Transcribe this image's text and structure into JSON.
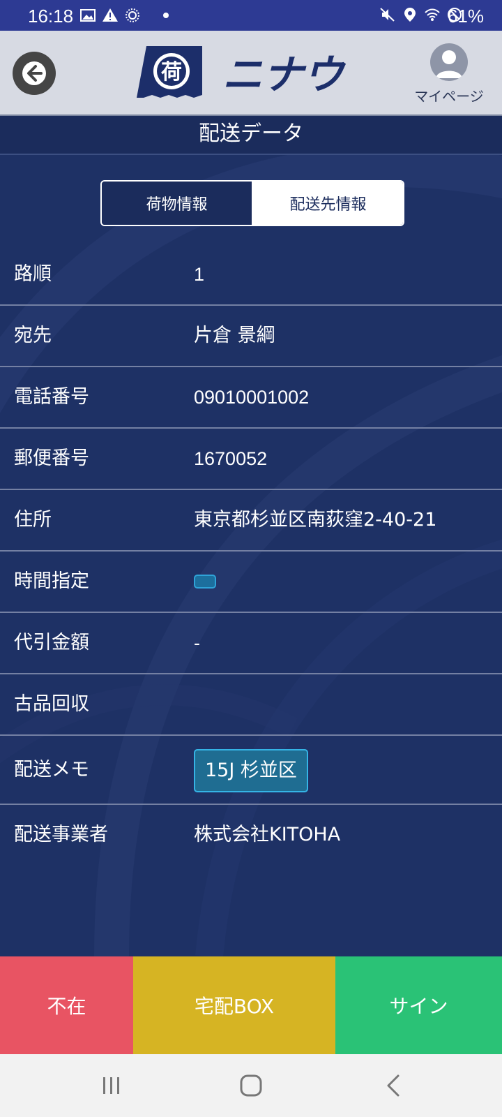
{
  "status_bar": {
    "time": "16:18",
    "left_icons": [
      "image-icon",
      "warning-icon",
      "sync-icon",
      "dot-icon"
    ],
    "right_icons": [
      "mute-icon",
      "location-icon",
      "wifi-icon",
      "dnd-icon"
    ],
    "battery": "61%"
  },
  "header": {
    "logo_text": "ニナウ",
    "logo_mark": "荷",
    "mypage_label": "マイページ"
  },
  "title": "配送データ",
  "tabs": [
    {
      "label": "荷物情報",
      "active": false
    },
    {
      "label": "配送先情報",
      "active": true
    }
  ],
  "rows": [
    {
      "label": "路順",
      "value": "1"
    },
    {
      "label": "宛先",
      "value": "片倉 景綱"
    },
    {
      "label": "電話番号",
      "value": "09010001002"
    },
    {
      "label": "郵便番号",
      "value": "1670052"
    },
    {
      "label": "住所",
      "value": "東京都杉並区南荻窪2-40-21"
    },
    {
      "label": "時間指定",
      "value": ""
    },
    {
      "label": "代引金額",
      "value": "-"
    },
    {
      "label": "古品回収",
      "value": ""
    },
    {
      "label": "配送メモ",
      "value": "15J 杉並区"
    },
    {
      "label": "配送事業者",
      "value": "株式会社KITOHA"
    }
  ],
  "actions": {
    "absent": "不在",
    "delivery_box": "宅配BOX",
    "sign": "サイン"
  },
  "colors": {
    "status_bar": "#2d3a93",
    "header_bg": "#d7dae3",
    "main_bg": "#1e3165",
    "absent": "#e85463",
    "delivery_box": "#d6b423",
    "sign": "#2ac276"
  }
}
